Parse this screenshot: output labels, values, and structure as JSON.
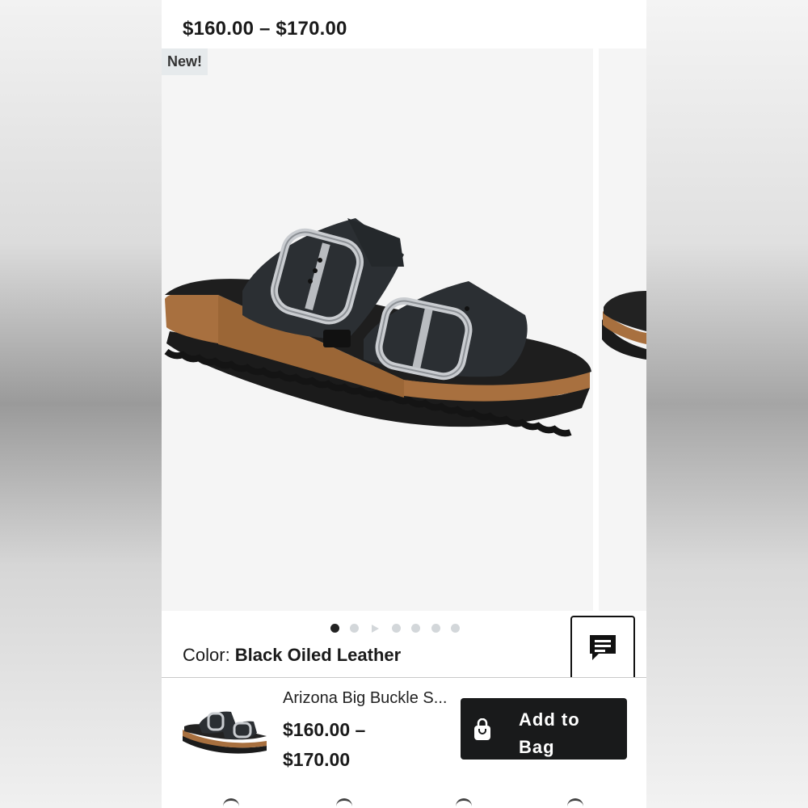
{
  "product": {
    "price_range": "$160.00 – $170.00",
    "badge": "New!",
    "name": "Arizona Big Buckle S...",
    "price_line1": "$160.00 –",
    "price_line2": "$170.00"
  },
  "color": {
    "label": "Color: ",
    "value": "Black Oiled Leather"
  },
  "carousel": {
    "dot_count": 7,
    "active_index": 0,
    "video_index": 2
  },
  "actions": {
    "add_to_bag_line1": "Add to",
    "add_to_bag_line2": "Bag"
  },
  "icons": {
    "chat": "chat-bubble-icon",
    "bag": "shopping-bag-icon"
  },
  "colors": {
    "button_bg": "#191a1b",
    "badge_bg": "#e6eaec",
    "image_bg": "#f5f5f5"
  }
}
